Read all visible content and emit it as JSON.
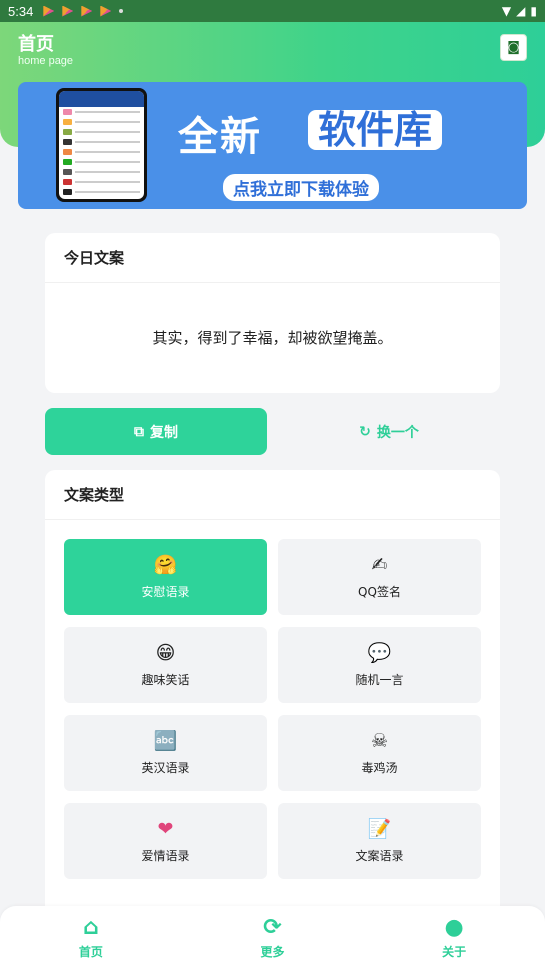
{
  "status_bar": {
    "time": "5:34"
  },
  "header": {
    "title": "首页",
    "subtitle": "home page"
  },
  "banner": {
    "headline": "全新",
    "chip": "软件库",
    "cta": "点我立即下载体验"
  },
  "today": {
    "title": "今日文案",
    "quote": "其实，得到了幸福，却被欲望掩盖。"
  },
  "actions": {
    "copy_label": "复制",
    "swap_label": "换一个"
  },
  "types": {
    "title": "文案类型",
    "items": [
      {
        "label": "安慰语录",
        "icon": "hug-emoji-icon",
        "glyph": "🤗"
      },
      {
        "label": "QQ签名",
        "icon": "pen-icon",
        "glyph": "✍"
      },
      {
        "label": "趣味笑话",
        "icon": "grin-emoji-icon",
        "glyph": "😁"
      },
      {
        "label": "随机一言",
        "icon": "speech-bubble-icon",
        "glyph": "💬"
      },
      {
        "label": "英汉语录",
        "icon": "abc-icon",
        "glyph": "🔤"
      },
      {
        "label": "毒鸡汤",
        "icon": "skull-icon",
        "glyph": "☠"
      },
      {
        "label": "爱情语录",
        "icon": "heart-icon",
        "glyph": "❤"
      },
      {
        "label": "文案语录",
        "icon": "notepad-icon",
        "glyph": "📝"
      }
    ]
  },
  "nav": [
    {
      "label": "首页",
      "icon": "home-icon",
      "glyph": "⌂"
    },
    {
      "label": "更多",
      "icon": "more-icon",
      "glyph": "⟳"
    },
    {
      "label": "关于",
      "icon": "user-icon",
      "glyph": "●"
    }
  ],
  "colors": {
    "accent": "#2ed39a",
    "banner": "#4a90e8"
  }
}
